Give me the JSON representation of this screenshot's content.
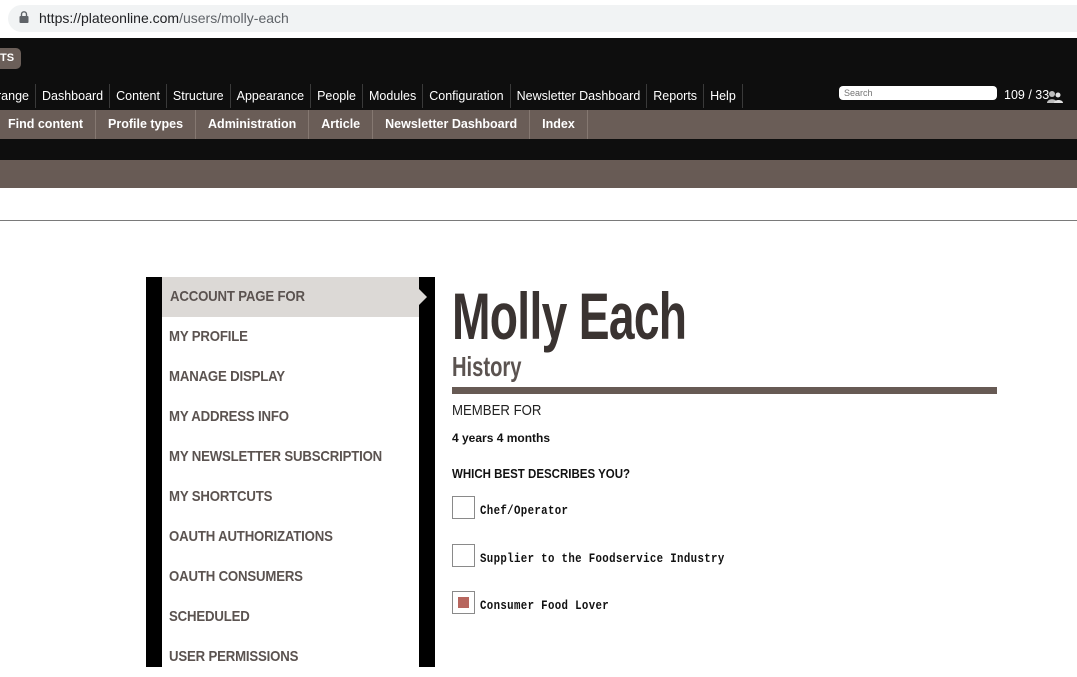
{
  "browser": {
    "url_host": "https://plateonline.com",
    "url_path": "/users/molly-each"
  },
  "toolbar": {
    "badge_label": "TS",
    "admin_menu": [
      "range",
      "Dashboard",
      "Content",
      "Structure",
      "Appearance",
      "People",
      "Modules",
      "Configuration",
      "Newsletter Dashboard",
      "Reports",
      "Help"
    ],
    "search_placeholder": "Search",
    "user_count": "109 / 33"
  },
  "shortcuts": [
    "Find content",
    "Profile types",
    "Administration",
    "Article",
    "Newsletter Dashboard",
    "Index"
  ],
  "sidebar": {
    "items": [
      {
        "label": "ACCOUNT PAGE FOR",
        "active": true
      },
      {
        "label": "MY PROFILE"
      },
      {
        "label": "MANAGE DISPLAY"
      },
      {
        "label": "MY ADDRESS INFO"
      },
      {
        "label": "MY NEWSLETTER SUBSCRIPTION"
      },
      {
        "label": "MY SHORTCUTS"
      },
      {
        "label": "OAUTH AUTHORIZATIONS"
      },
      {
        "label": "OAUTH CONSUMERS"
      },
      {
        "label": "SCHEDULED"
      },
      {
        "label": "USER PERMISSIONS"
      }
    ]
  },
  "profile": {
    "name": "Molly Each",
    "section_title": "History",
    "member_for_label": "MEMBER FOR",
    "member_for_value": "4 years 4 months",
    "question": "WHICH BEST DESCRIBES YOU?",
    "options": [
      {
        "label": "Chef/Operator",
        "checked": false
      },
      {
        "label": "Supplier to the Foodservice Industry",
        "checked": false
      },
      {
        "label": "Consumer Food Lover",
        "checked": true
      }
    ]
  },
  "colors": {
    "brown_bar": "#6a5d57",
    "checkbox_fill": "#b7665e",
    "active_nav_bg": "#dcd9d6"
  }
}
